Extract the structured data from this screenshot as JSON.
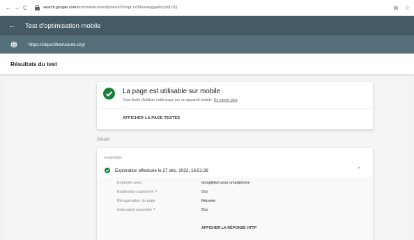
{
  "browser": {
    "url_prefix": "search.google.com",
    "url_suffix": "/test/mobile-friendly/result?id=pLYx30lunwuggw8oq3qLDQ",
    "nav": {
      "back": "←",
      "forward": "→",
      "reload": "C"
    },
    "icons": {
      "share": "⧉",
      "star": "☆"
    }
  },
  "header": {
    "back_icon": "←",
    "title": "Test d'optimisation mobile"
  },
  "tested_url": "https://objectifreinsante.org/",
  "results_title": "Résultats du test",
  "summary": {
    "title": "La page est utilisable sur mobile",
    "description": "Il est facile d'utiliser cette page sur un appareil mobile.",
    "learn_more": "En savoir plus",
    "show_page_button": "AFFICHER LA PAGE TESTÉE"
  },
  "details_label": "Détails",
  "crawl": {
    "heading": "Exploration",
    "summary": "Exploration effectuée le 27 déc. 2022, 16:51:26",
    "rows": [
      {
        "label": "Explorée avec",
        "value": "Googlebot pour smartphone"
      },
      {
        "label": "Exploration autorisée ?",
        "value": "Oui"
      },
      {
        "label": "Récupération de page",
        "value": "Réussie"
      },
      {
        "label": "Indexation autorisée ?",
        "value": "Oui"
      }
    ],
    "http_button": "AFFICHER LA RÉPONSE HTTP"
  },
  "colors": {
    "header_bg": "#455a64",
    "url_bar_bg": "#546e7a",
    "success_green": "#188038"
  }
}
